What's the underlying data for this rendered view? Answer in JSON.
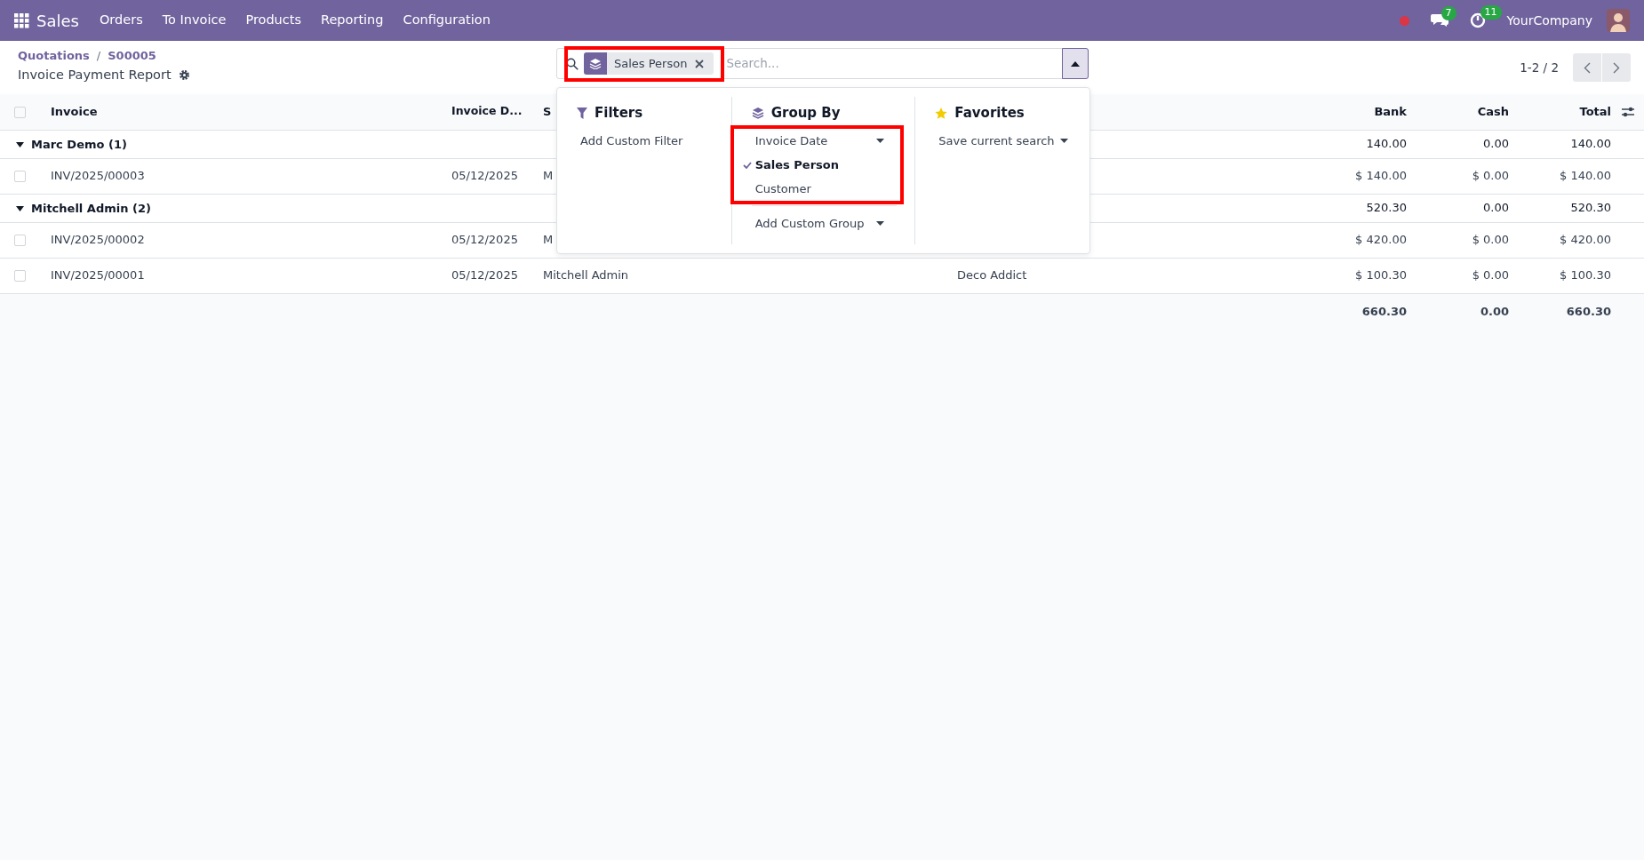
{
  "navbar": {
    "app": "Sales",
    "menu": [
      "Orders",
      "To Invoice",
      "Products",
      "Reporting",
      "Configuration"
    ],
    "chat_count": "7",
    "activity_count": "11",
    "company": "YourCompany"
  },
  "breadcrumb": {
    "items": [
      "Quotations",
      "S00005"
    ],
    "separator": "/"
  },
  "title": "Invoice Payment Report",
  "search": {
    "facet": {
      "label": "Sales Person",
      "highlighted": true
    },
    "placeholder": "Search...",
    "expanded": true
  },
  "pager": "1-2 / 2",
  "dropdown": {
    "filters": {
      "title": "Filters",
      "items": [
        "Add Custom Filter"
      ]
    },
    "group_by": {
      "title": "Group By",
      "highlighted": true,
      "options": [
        {
          "label": "Invoice Date",
          "selected": false,
          "submenu": true
        },
        {
          "label": "Sales Person",
          "selected": true,
          "submenu": false
        },
        {
          "label": "Customer",
          "selected": false,
          "submenu": false
        }
      ],
      "custom": "Add Custom Group"
    },
    "favorites": {
      "title": "Favorites",
      "items": [
        "Save current search"
      ]
    }
  },
  "table": {
    "select_all": {
      "checked": false
    },
    "columns": [
      "Invoice",
      "Invoice D...",
      "S",
      "Bank",
      "Cash",
      "Total"
    ],
    "rows": [
      {
        "kind": "group",
        "label": "Marc Demo (1)",
        "expanded": true,
        "bank": "140.00",
        "cash": "0.00",
        "total": "140.00"
      },
      {
        "kind": "record",
        "checked": false,
        "invoice": "INV/2025/00003",
        "date": "05/12/2025",
        "salesperson": "M",
        "bank": "$ 140.00",
        "cash": "$ 0.00",
        "total": "$ 140.00"
      },
      {
        "kind": "group",
        "label": "Mitchell Admin (2)",
        "expanded": true,
        "bank": "520.30",
        "cash": "0.00",
        "total": "520.30"
      },
      {
        "kind": "record",
        "checked": false,
        "invoice": "INV/2025/00002",
        "date": "05/12/2025",
        "salesperson": "M",
        "bank": "$ 420.00",
        "cash": "$ 0.00",
        "total": "$ 420.00"
      },
      {
        "kind": "record",
        "checked": false,
        "invoice": "INV/2025/00001",
        "date": "05/12/2025",
        "salesperson": "Mitchell Admin",
        "customer": "Deco Addict",
        "bank": "$ 100.30",
        "cash": "$ 0.00",
        "total": "$ 100.30"
      }
    ],
    "totals": {
      "bank": "660.30",
      "cash": "0.00",
      "total": "660.30"
    }
  }
}
